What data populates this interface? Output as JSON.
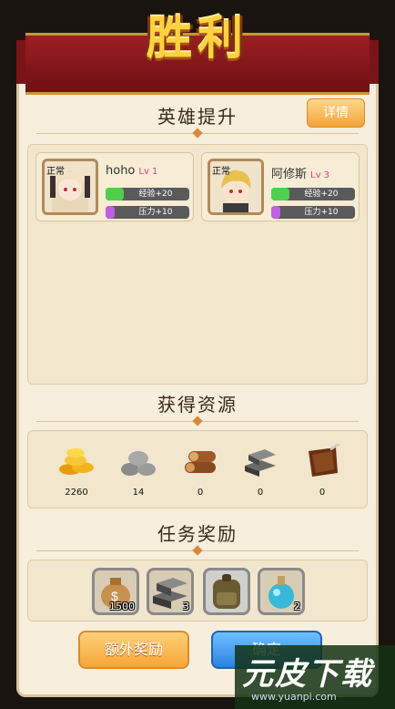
{
  "banner": {
    "title": "胜利"
  },
  "sections": {
    "hero_title": "英雄提升",
    "resource_title": "获得资源",
    "task_title": "任务奖励"
  },
  "detail_button": "详情",
  "heroes": [
    {
      "tag": "正常",
      "name": "hoho",
      "level": "Lv 1",
      "exp": "经验+20",
      "stress": "压力+10"
    },
    {
      "tag": "正常",
      "name": "阿修斯",
      "level": "Lv 3",
      "exp": "经验+20",
      "stress": "压力+10"
    }
  ],
  "resources": [
    {
      "icon": "gold-coins-icon",
      "value": "2260"
    },
    {
      "icon": "stone-icon",
      "value": "14"
    },
    {
      "icon": "wood-logs-icon",
      "value": "0"
    },
    {
      "icon": "iron-ingot-icon",
      "value": "0"
    },
    {
      "icon": "leather-icon",
      "value": "0"
    }
  ],
  "rewards": [
    {
      "icon": "money-bag-icon",
      "count": "1500"
    },
    {
      "icon": "iron-ingot-icon",
      "count": "3"
    },
    {
      "icon": "backpack-icon",
      "count": ""
    },
    {
      "icon": "potion-icon",
      "count": "2"
    }
  ],
  "buttons": {
    "extra": "额外奖励",
    "confirm": "确定"
  },
  "watermark": {
    "text": "元皮下载",
    "url": "www.yuanpi.com"
  },
  "colors": {
    "banner": "#8a1a1e",
    "title": "#ffd23f",
    "level": "#e0408a",
    "exp_fill": "#4ed04e",
    "stress_fill": "#c060e0"
  }
}
